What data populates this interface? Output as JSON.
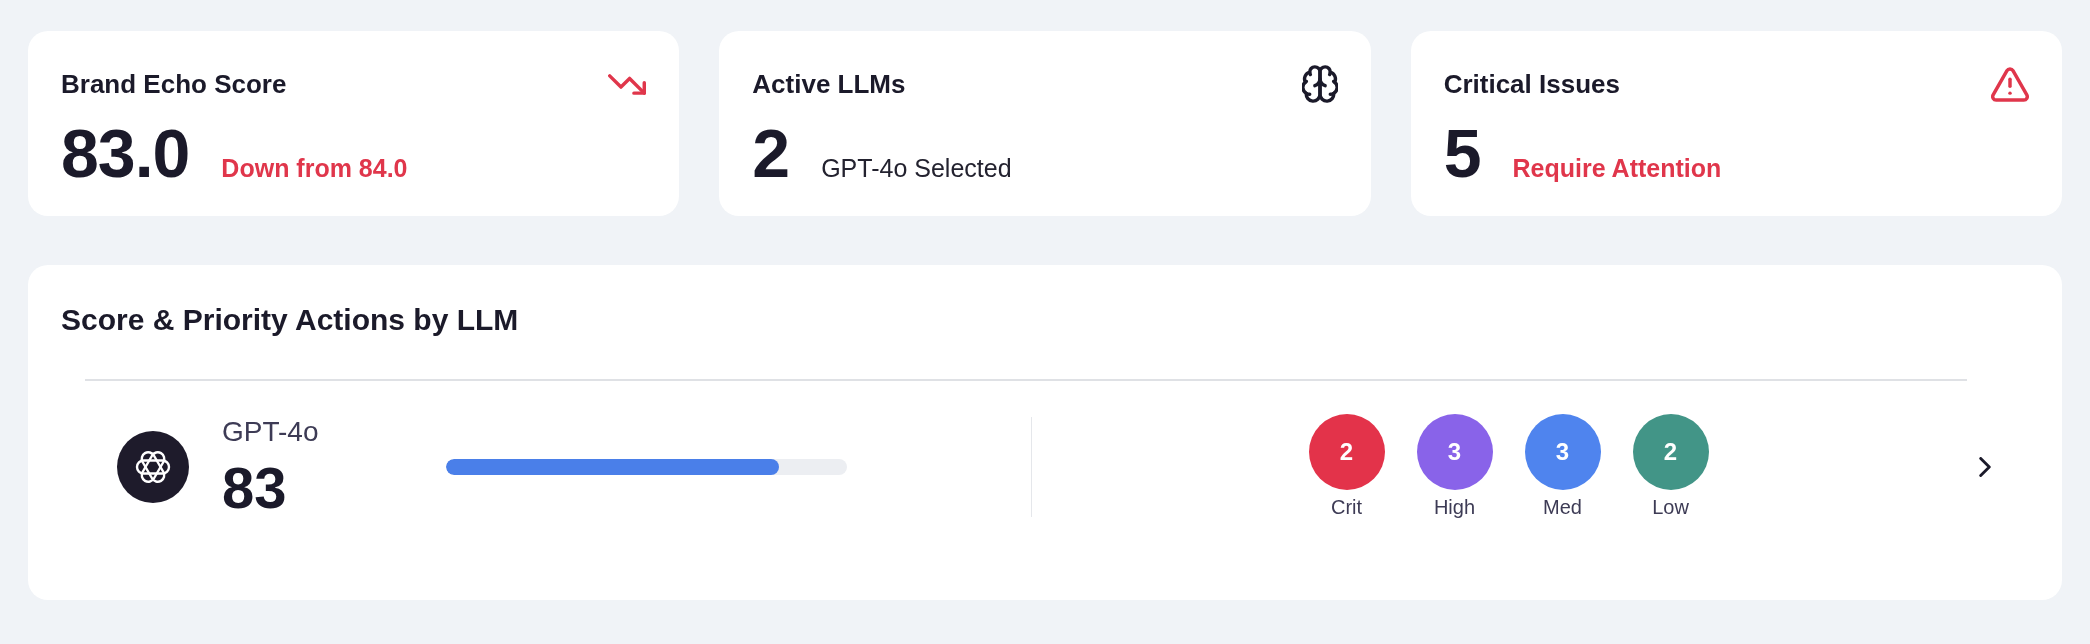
{
  "stat_cards": [
    {
      "kind": "trend",
      "title": "Brand Echo Score",
      "value": "83.0",
      "note": "Down from 84.0",
      "alert": true
    },
    {
      "kind": "brain",
      "title": "Active LLMs",
      "value": "2",
      "note": "GPT-4o Selected",
      "alert": false
    },
    {
      "kind": "warning",
      "title": "Critical Issues",
      "value": "5",
      "note": "Require Attention",
      "alert": true
    }
  ],
  "panel": {
    "title": "Score & Priority Actions by LLM",
    "llms": [
      {
        "name": "GPT-4o",
        "score": "83",
        "level": 0.83,
        "priorities": [
          {
            "count": "2",
            "label": "Crit",
            "color": "#e3334a"
          },
          {
            "count": "3",
            "label": "High",
            "color": "#8963e9"
          },
          {
            "count": "3",
            "label": "Med",
            "color": "#4f84ee"
          },
          {
            "count": "2",
            "label": "Low",
            "color": "#429587"
          }
        ]
      }
    ]
  }
}
